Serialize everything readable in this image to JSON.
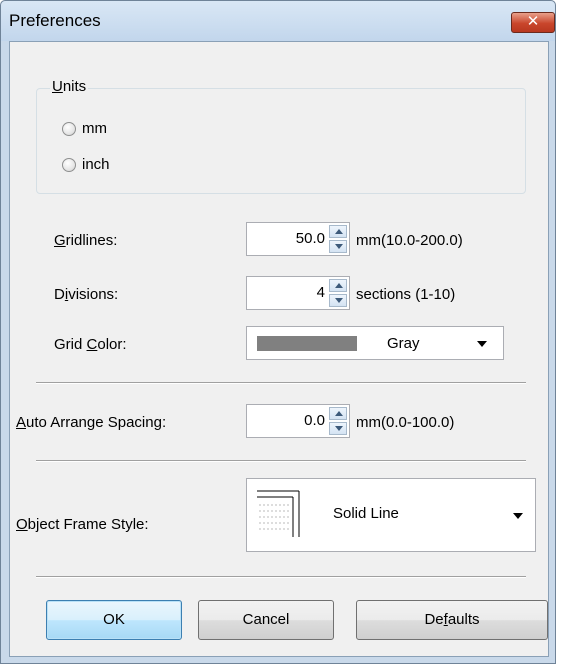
{
  "window": {
    "title": "Preferences",
    "close_glyph": "✕"
  },
  "units": {
    "group_label": "Units",
    "options": [
      {
        "label": "mm",
        "selected": false
      },
      {
        "label": "inch",
        "selected": false
      }
    ]
  },
  "gridlines": {
    "label": "Gridlines:",
    "value": "50.0",
    "unit_text": "mm(10.0-200.0)"
  },
  "divisions": {
    "label": "Divisions:",
    "value": "4",
    "unit_text": "sections (1-10)"
  },
  "grid_color": {
    "label": "Grid Color:",
    "value": "Gray",
    "swatch_color": "#808080"
  },
  "auto_arrange": {
    "label": "Auto Arrange Spacing:",
    "value": "0.0",
    "unit_text": "mm(0.0-100.0)"
  },
  "object_frame": {
    "label": "Object Frame Style:",
    "value": "Solid Line"
  },
  "buttons": {
    "ok": "OK",
    "cancel": "Cancel",
    "defaults": "Defaults"
  },
  "icons": {
    "close": "close-icon",
    "spin_up": "spin-up-icon",
    "spin_down": "spin-down-icon",
    "dropdown": "chevron-down-icon"
  }
}
